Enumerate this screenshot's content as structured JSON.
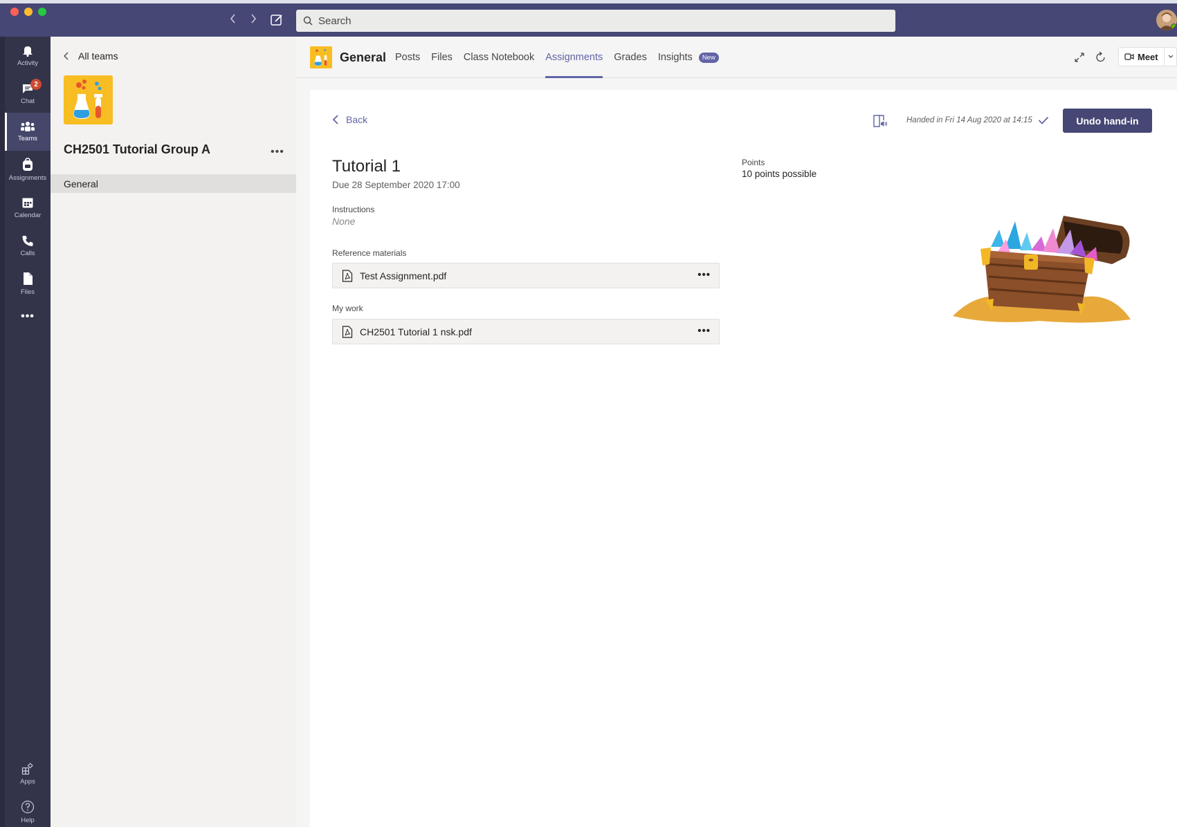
{
  "titlebar": {
    "search_placeholder": "Search"
  },
  "rail": {
    "items": [
      {
        "label": "Activity",
        "icon": "bell-icon"
      },
      {
        "label": "Chat",
        "icon": "chat-icon",
        "badge": "2"
      },
      {
        "label": "Teams",
        "icon": "teams-icon",
        "active": true
      },
      {
        "label": "Assignments",
        "icon": "backpack-icon"
      },
      {
        "label": "Calendar",
        "icon": "calendar-icon"
      },
      {
        "label": "Calls",
        "icon": "phone-icon"
      },
      {
        "label": "Files",
        "icon": "file-icon"
      }
    ],
    "more": "•••",
    "bottom": [
      {
        "label": "Apps",
        "icon": "apps-icon"
      },
      {
        "label": "Help",
        "icon": "help-icon"
      }
    ]
  },
  "teampanel": {
    "back_label": "All teams",
    "team_name": "CH2501 Tutorial Group A",
    "more": "•••",
    "channels": [
      "General"
    ]
  },
  "header": {
    "channel_name": "General",
    "tabs": [
      "Posts",
      "Files",
      "Class Notebook",
      "Assignments",
      "Grades",
      "Insights"
    ],
    "active_tab": "Assignments",
    "new_pill": "New",
    "meet_label": "Meet"
  },
  "assignment": {
    "back_label": "Back",
    "handed_in_text": "Handed in Fri 14 Aug 2020 at 14:15",
    "undo_label": "Undo hand-in",
    "title": "Tutorial 1",
    "due": "Due 28 September 2020 17:00",
    "points_label": "Points",
    "points_value": "10 points possible",
    "instructions_label": "Instructions",
    "instructions_value": "None",
    "reference_label": "Reference materials",
    "reference_files": [
      "Test Assignment.pdf"
    ],
    "mywork_label": "My work",
    "mywork_files": [
      "CH2501 Tutorial 1 nsk.pdf"
    ],
    "file_more": "•••"
  },
  "colors": {
    "brand": "#464775",
    "accent": "#6264a7",
    "team_logo": "#f7bd23",
    "badge": "#cc4a31"
  }
}
